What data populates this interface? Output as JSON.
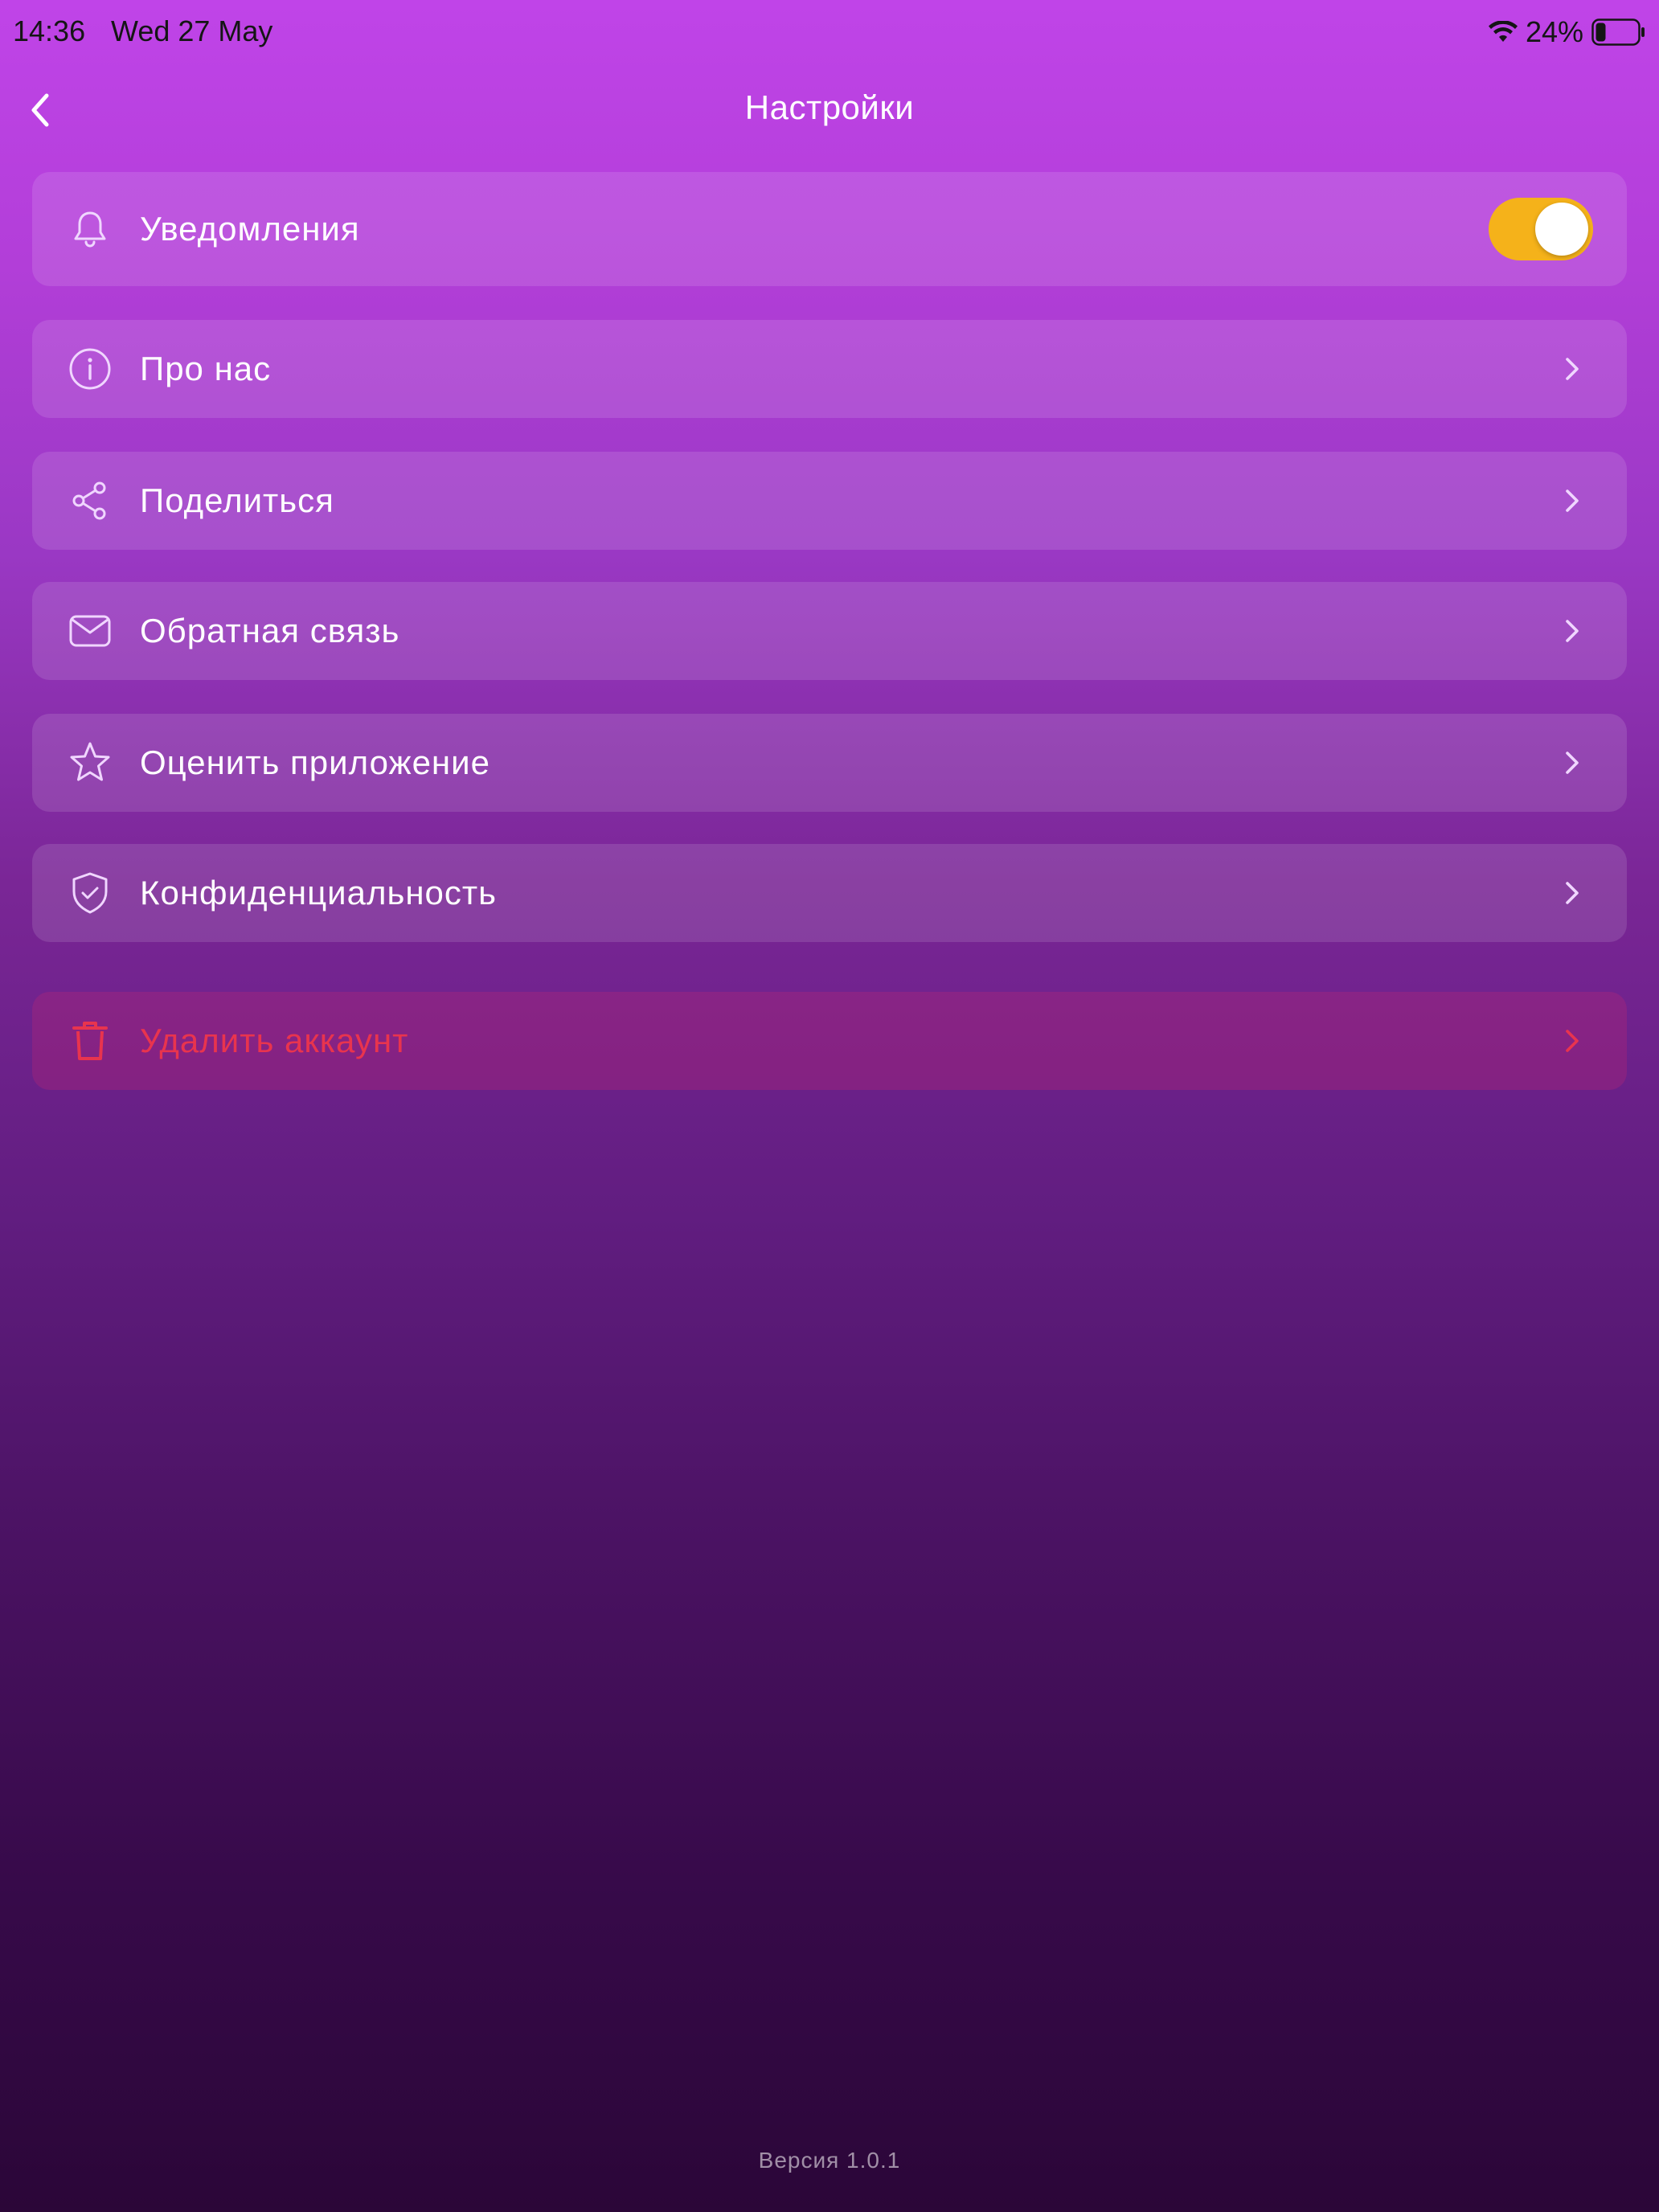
{
  "status_bar": {
    "time": "14:36",
    "date": "Wed 27 May",
    "battery_percent": "24%",
    "battery_level": 0.24,
    "wifi_icon": "wifi-icon",
    "battery_icon": "battery-icon"
  },
  "header": {
    "title": "Настройки",
    "back_icon": "chevron-left-icon"
  },
  "settings": {
    "notifications": {
      "label": "Уведомления",
      "icon": "bell-icon",
      "enabled": true
    },
    "about": {
      "label": "Про нас",
      "icon": "info-icon"
    },
    "share": {
      "label": "Поделиться",
      "icon": "share-icon"
    },
    "feedback": {
      "label": "Обратная связь",
      "icon": "mail-icon"
    },
    "rate": {
      "label": "Оценить приложение",
      "icon": "star-icon"
    },
    "privacy": {
      "label": "Конфиденциальность",
      "icon": "shield-check-icon"
    },
    "delete_account": {
      "label": "Удалить аккаунт",
      "icon": "trash-icon"
    }
  },
  "footer": {
    "version": "Версия 1.0.1"
  },
  "colors": {
    "toggle_on": "#f5b21a",
    "danger": "#e8344e",
    "gradient_top": "#c044e8",
    "gradient_bottom": "#2b0638"
  }
}
